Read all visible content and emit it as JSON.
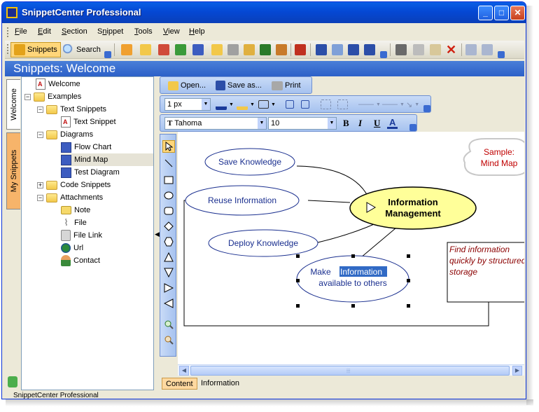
{
  "window": {
    "title": "SnippetCenter Professional"
  },
  "menu": [
    {
      "pre": "",
      "ul": "F",
      "post": "ile"
    },
    {
      "pre": "",
      "ul": "E",
      "post": "dit"
    },
    {
      "pre": "",
      "ul": "S",
      "post": "ection"
    },
    {
      "pre": "S",
      "ul": "n",
      "post": "ippet"
    },
    {
      "pre": "",
      "ul": "T",
      "post": "ools"
    },
    {
      "pre": "",
      "ul": "V",
      "post": "iew"
    },
    {
      "pre": "",
      "ul": "H",
      "post": "elp"
    }
  ],
  "toolbar": {
    "snippets_label": "Snippets",
    "search_label": "Search"
  },
  "banner": "Snippets: Welcome",
  "sidetabs": {
    "welcome": "Welcome",
    "my_snippets": "My Snippets"
  },
  "tree": [
    {
      "label": "Welcome",
      "icon": "document-icon"
    },
    {
      "label": "Examples",
      "icon": "folder-icon"
    },
    {
      "label": "Text Snippets",
      "icon": "folder-icon"
    },
    {
      "label": "Text Snippet",
      "icon": "document-icon"
    },
    {
      "label": "Diagrams",
      "icon": "folder-icon"
    },
    {
      "label": "Flow Chart",
      "icon": "diagram-icon"
    },
    {
      "label": "Mind Map",
      "icon": "diagram-icon"
    },
    {
      "label": "Test Diagram",
      "icon": "diagram-icon"
    },
    {
      "label": "Code Snippets",
      "icon": "folder-icon"
    },
    {
      "label": "Attachments",
      "icon": "folder-icon"
    },
    {
      "label": "Note",
      "icon": "note-icon"
    },
    {
      "label": "File",
      "icon": "paperclip-icon"
    },
    {
      "label": "File Link",
      "icon": "file-link-icon"
    },
    {
      "label": "Url",
      "icon": "globe-icon"
    },
    {
      "label": "Contact",
      "icon": "contact-icon"
    }
  ],
  "editor_toolbar": {
    "open_label": "Open...",
    "save_as_label": "Save as...",
    "print_label": "Print",
    "line_width": "1 px",
    "font_name": "Tahoma",
    "font_size": "10",
    "bold": "B",
    "italic": "I",
    "underline": "U",
    "font_color": "A"
  },
  "diagram": {
    "save_knowledge": "Save Knowledge",
    "reuse_information": "Reuse Information",
    "deploy_knowledge": "Deploy Knowledge",
    "center_line1": "Information",
    "center_line2": "Management",
    "make_prefix": "Make ",
    "make_selected": "Information",
    "make_line2": "available to others",
    "sample_line1": "Sample:",
    "sample_line2": "Mind Map",
    "note_line1": "Find information",
    "note_line2": "quickly by structured",
    "note_line3": "storage"
  },
  "bottom_tabs": {
    "content": "Content",
    "information": "Information"
  },
  "statusbar": "SnippetCenter Professional",
  "colors": {
    "title_blue": "#0548d4",
    "center_fill": "#ffff99",
    "sample_text": "#c00000",
    "note_text": "#8b0000",
    "selection": "#316ac5"
  }
}
